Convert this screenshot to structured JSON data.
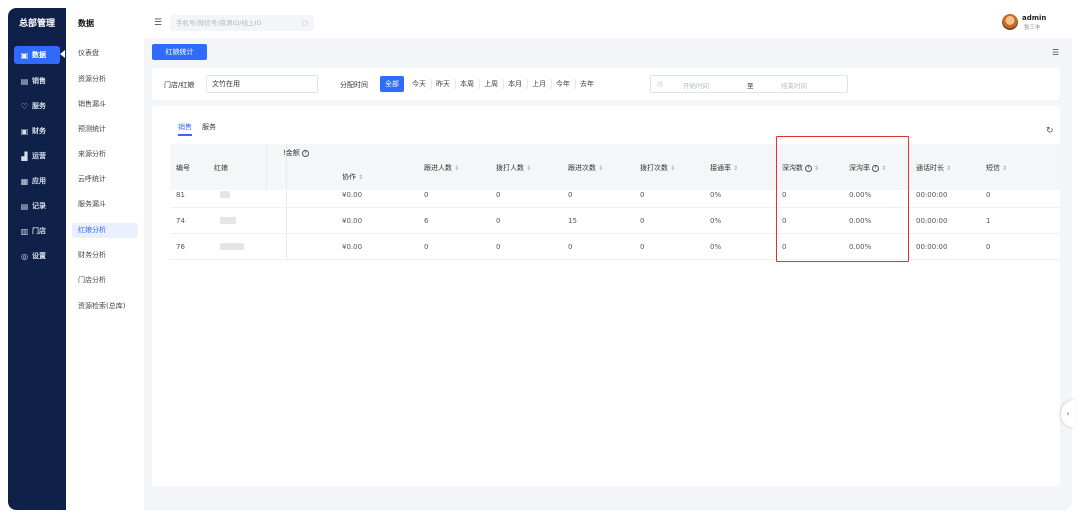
{
  "sidebar": {
    "brand": "总部管理",
    "items": [
      {
        "icon": "bar-chart-icon",
        "glyph": "▣",
        "label": "数据",
        "active": true
      },
      {
        "icon": "receipt-icon",
        "glyph": "▤",
        "label": "销售"
      },
      {
        "icon": "heart-icon",
        "glyph": "♡",
        "label": "服务"
      },
      {
        "icon": "finance-icon",
        "glyph": "▣",
        "label": "财务"
      },
      {
        "icon": "operations-icon",
        "glyph": "▟",
        "label": "运营"
      },
      {
        "icon": "apps-icon",
        "glyph": "▦",
        "label": "应用"
      },
      {
        "icon": "record-icon",
        "glyph": "▤",
        "label": "记录"
      },
      {
        "icon": "store-icon",
        "glyph": "▥",
        "label": "门店"
      },
      {
        "icon": "settings-icon",
        "glyph": "◎",
        "label": "设置"
      }
    ]
  },
  "subnav": {
    "title": "数据",
    "items": [
      {
        "label": "仪表盘"
      },
      {
        "label": "资源分析"
      },
      {
        "label": "销售漏斗"
      },
      {
        "label": "预测统计"
      },
      {
        "label": "来源分析"
      },
      {
        "label": "云呼统计"
      },
      {
        "label": "服务漏斗"
      },
      {
        "label": "红娘分析",
        "active": true
      },
      {
        "label": "财务分析"
      },
      {
        "label": "门店分析"
      },
      {
        "label": "资源检索(总库)"
      }
    ]
  },
  "header": {
    "search_placeholder": "手机号/微信号/资源ID/线上ID",
    "user_name": "admin",
    "user_sub": "张三丰"
  },
  "tabs": {
    "active_label": "红娘统计"
  },
  "filters": {
    "store_label": "门店/红娘",
    "store_value": "文竹在用",
    "time_label": "分配时间",
    "ranges": [
      "全部",
      "今天",
      "昨天",
      "本周",
      "上周",
      "本月",
      "上月",
      "今年",
      "去年"
    ],
    "active_range": "全部",
    "start_placeholder": "开始时间",
    "to_label": "至",
    "end_placeholder": "结束时间"
  },
  "panel": {
    "tabs": [
      "销售",
      "服务"
    ],
    "active_tab": "销售",
    "columns": {
      "id": "编号",
      "matchmaker": "红娘",
      "amount_partial": "!金额",
      "coop": "协作",
      "follow_people": "跟进人数",
      "dial_people": "拨打人数",
      "follow_times": "跟进次数",
      "dial_times": "拨打次数",
      "connect_rate": "接通率",
      "deep_count": "深沟数",
      "deep_rate": "深沟率",
      "call_duration": "通话时长",
      "sms": "短信"
    },
    "rows": [
      {
        "id": "81",
        "coop": "¥0.00",
        "follow_people": "0",
        "dial_people": "0",
        "follow_times": "0",
        "dial_times": "0",
        "connect_rate": "0%",
        "deep_count": "0",
        "deep_rate": "0.00%",
        "call_duration": "00:00:00",
        "sms": "0"
      },
      {
        "id": "74",
        "coop": "¥0.00",
        "follow_people": "6",
        "dial_people": "0",
        "follow_times": "15",
        "dial_times": "0",
        "connect_rate": "0%",
        "deep_count": "0",
        "deep_rate": "0.00%",
        "call_duration": "00:00:00",
        "sms": "1"
      },
      {
        "id": "76",
        "coop": "¥0.00",
        "follow_people": "0",
        "dial_people": "0",
        "follow_times": "0",
        "dial_times": "0",
        "connect_rate": "0%",
        "deep_count": "0",
        "deep_rate": "0.00%",
        "call_duration": "00:00:00",
        "sms": "0"
      }
    ]
  },
  "colors": {
    "primary": "#2f6bff",
    "sidebar_bg": "#0f2148",
    "highlight": "#e0322f"
  }
}
